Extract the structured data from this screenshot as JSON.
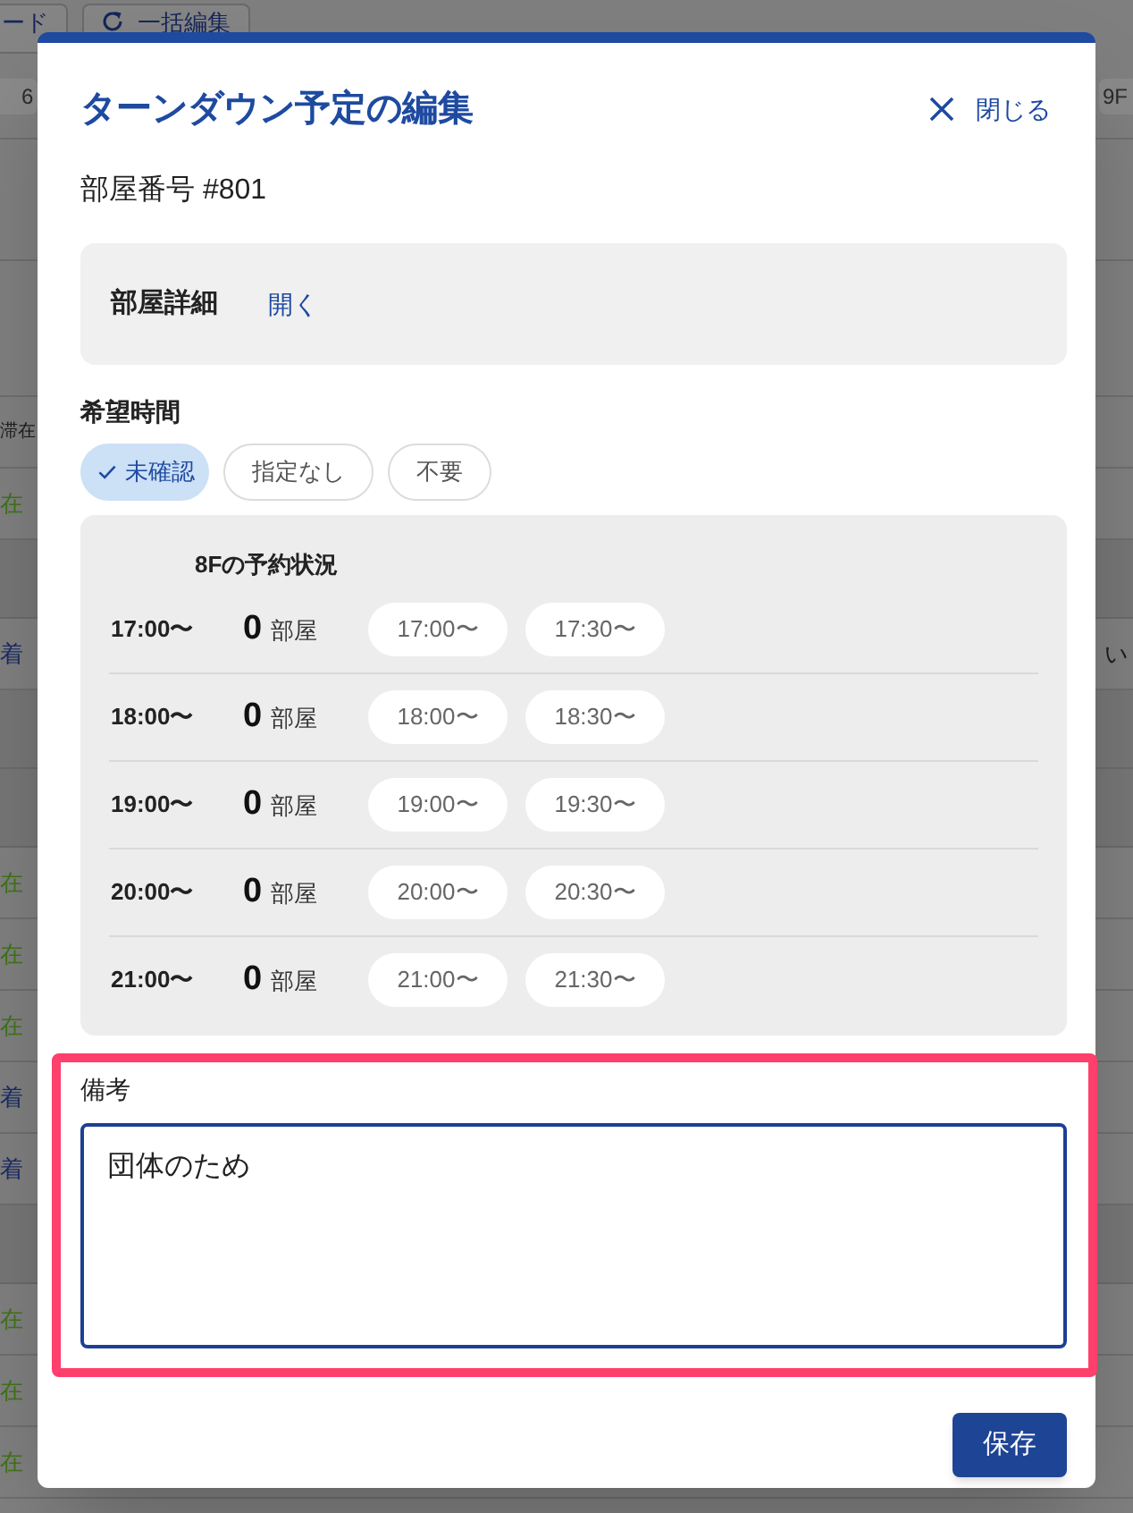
{
  "background": {
    "toolbar_buttons": [
      {
        "kind": "label",
        "label": "ード"
      },
      {
        "kind": "icon_label",
        "label": "一括編集"
      }
    ],
    "floor_tabs": [
      "6",
      "9F"
    ],
    "rows": [
      {
        "kind": "header",
        "left": "滞在"
      },
      {
        "kind": "status",
        "left": "在",
        "color": "#3f7419"
      },
      {
        "kind": "group"
      },
      {
        "kind": "status",
        "left": "着",
        "color": "#1b2c66",
        "right": "い"
      },
      {
        "kind": "group"
      },
      {
        "kind": "group"
      },
      {
        "kind": "status",
        "left": "在",
        "color": "#3f7419"
      },
      {
        "kind": "status",
        "left": "在",
        "color": "#3f7419"
      },
      {
        "kind": "status",
        "left": "在",
        "color": "#3f7419"
      },
      {
        "kind": "status",
        "left": "着",
        "color": "#1b2c66"
      },
      {
        "kind": "status",
        "left": "着",
        "color": "#1b2c66"
      },
      {
        "kind": "group"
      },
      {
        "kind": "status",
        "left": "在",
        "color": "#3f7419"
      },
      {
        "kind": "status",
        "left": "在",
        "color": "#3f7419"
      },
      {
        "kind": "status",
        "left": "在",
        "color": "#3f7419"
      }
    ]
  },
  "dialog": {
    "title": "ターンダウン予定の編集",
    "close_button": {
      "label": "閉じる"
    },
    "room_number": "部屋番号 #801",
    "details_card": {
      "title": "部屋詳細",
      "toggle_link": "開く"
    },
    "time_preference": {
      "label": "希望時間",
      "options": [
        {
          "label": "未確認",
          "selected": true
        },
        {
          "label": "指定なし",
          "selected": false
        },
        {
          "label": "不要",
          "selected": false
        }
      ]
    },
    "availability": {
      "title": "8Fの予約状況",
      "rows": [
        {
          "time": "17:00〜",
          "count": "0",
          "unit": "部屋",
          "slots": [
            {
              "label": "17:00〜",
              "selected": false
            },
            {
              "label": "17:30〜",
              "selected": false
            }
          ]
        },
        {
          "time": "18:00〜",
          "count": "0",
          "unit": "部屋",
          "slots": [
            {
              "label": "18:00〜",
              "selected": false
            },
            {
              "label": "18:30〜",
              "selected": false
            }
          ]
        },
        {
          "time": "19:00〜",
          "count": "0",
          "unit": "部屋",
          "slots": [
            {
              "label": "19:00〜",
              "selected": false
            },
            {
              "label": "19:30〜",
              "selected": false
            }
          ]
        },
        {
          "time": "20:00〜",
          "count": "0",
          "unit": "部屋",
          "slots": [
            {
              "label": "20:00〜",
              "selected": false
            },
            {
              "label": "20:30〜",
              "selected": false
            }
          ]
        },
        {
          "time": "21:00〜",
          "count": "0",
          "unit": "部屋",
          "slots": [
            {
              "label": "21:00〜",
              "selected": false
            },
            {
              "label": "21:30〜",
              "selected": false
            }
          ]
        }
      ]
    },
    "notes": {
      "label": "備考",
      "value": "団体のため",
      "highlighted": true
    },
    "save_button": {
      "label": "保存"
    }
  }
}
